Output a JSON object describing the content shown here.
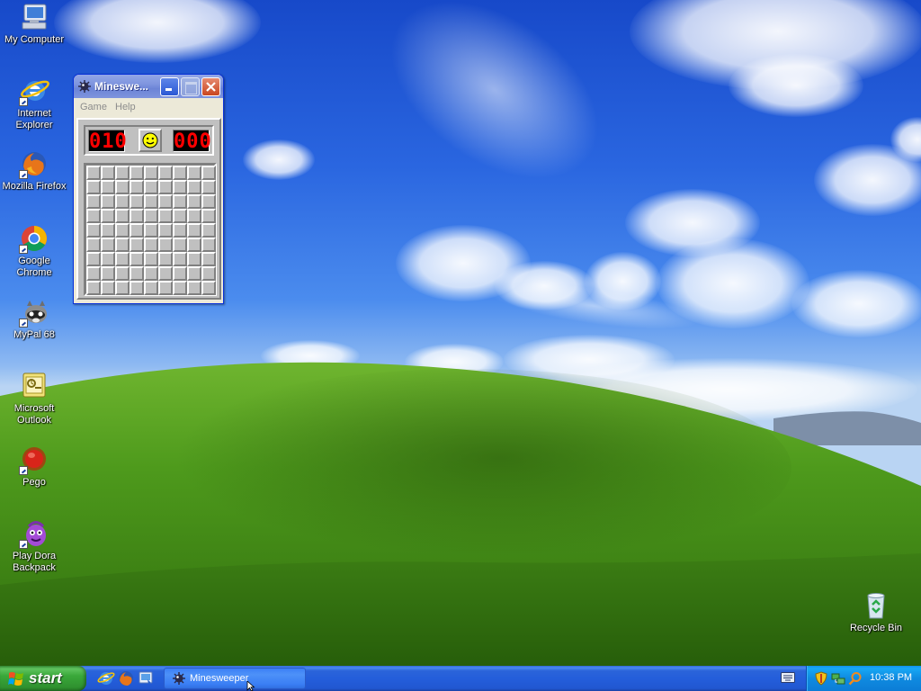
{
  "desktop": {
    "icons": [
      {
        "label": "My Computer",
        "icon": "my-computer-icon"
      },
      {
        "label": "Internet Explorer",
        "icon": "internet-explorer-icon"
      },
      {
        "label": "Mozilla Firefox",
        "icon": "firefox-icon"
      },
      {
        "label": "Google Chrome",
        "icon": "chrome-icon"
      },
      {
        "label": "MyPal 68",
        "icon": "mypal-icon"
      },
      {
        "label": "Microsoft Outlook",
        "icon": "outlook-icon"
      },
      {
        "label": "Pego",
        "icon": "pego-icon"
      },
      {
        "label": "Play Dora Backpack",
        "icon": "dora-backpack-icon"
      },
      {
        "label": "Recycle Bin",
        "icon": "recycle-bin-icon"
      }
    ]
  },
  "minesweeper": {
    "title": "Minesweeper",
    "title_display": "Mineswe...",
    "menu": {
      "game": "Game",
      "help": "Help"
    },
    "mine_counter": "010",
    "timer": "000",
    "face": "smiley",
    "grid": {
      "rows": 9,
      "cols": 9,
      "state": "all-covered"
    }
  },
  "taskbar": {
    "start_label": "start",
    "quick_launch": [
      "internet-explorer-icon",
      "firefox-icon",
      "show-desktop-icon"
    ],
    "tasks": [
      {
        "label": "Minesweeper",
        "icon": "minesweeper-icon",
        "active": true
      }
    ],
    "tray": {
      "icons": [
        "security-shield-icon",
        "network-icon",
        "search-icon"
      ],
      "clock": "10:38 PM"
    }
  },
  "colors": {
    "taskbar_blue": "#245edb",
    "start_green": "#3aa83a",
    "tray_blue": "#0f8ae0",
    "led_red": "#ff0000",
    "ms_gray": "#c0c0c0"
  }
}
